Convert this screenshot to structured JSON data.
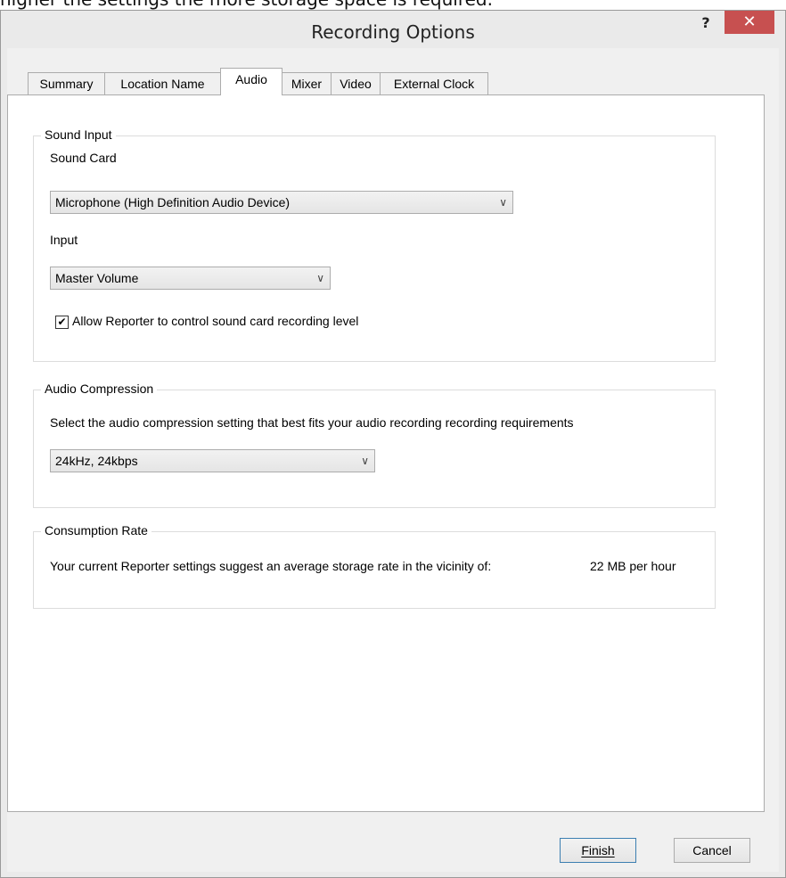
{
  "background_caption": "higher the settings the more storage space is required.",
  "window": {
    "title": "Recording Options",
    "help_label": "?",
    "close_label": "✕"
  },
  "tabs": [
    {
      "label": "Summary"
    },
    {
      "label": "Location Name"
    },
    {
      "label": "Audio"
    },
    {
      "label": "Mixer"
    },
    {
      "label": "Video"
    },
    {
      "label": "External Clock"
    }
  ],
  "active_tab": "Audio",
  "sound_input": {
    "legend": "Sound Input",
    "sound_card_label": "Sound Card",
    "sound_card_value": "Microphone (High Definition Audio Device)",
    "input_label": "Input",
    "input_value": "Master Volume",
    "allow_control_checked": true,
    "allow_control_label": "Allow Reporter to control sound card recording level"
  },
  "audio_compression": {
    "legend": "Audio Compression",
    "description": "Select the audio compression setting that best fits your audio recording recording requirements",
    "value": "24kHz, 24kbps"
  },
  "consumption_rate": {
    "legend": "Consumption Rate",
    "text": "Your current Reporter settings suggest an average storage rate in the vicinity of:",
    "rate": "22 MB per hour"
  },
  "buttons": {
    "finish": "Finish",
    "cancel": "Cancel"
  },
  "colors": {
    "close_button": "#c75050",
    "default_button_border": "#3c7fb1"
  }
}
